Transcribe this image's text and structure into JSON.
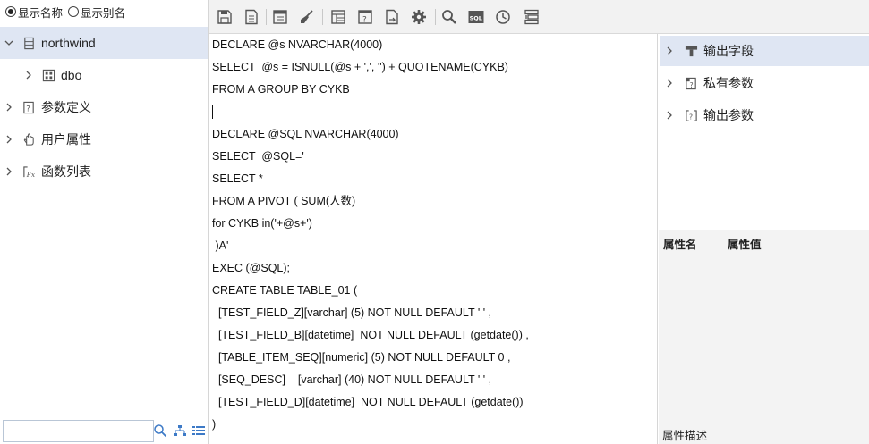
{
  "display_options": {
    "show_name": "显示名称",
    "show_alias": "显示别名",
    "selected": "show_name"
  },
  "tree": {
    "database": "northwind",
    "schema": "dbo",
    "params_def": "参数定义",
    "user_props": "用户属性",
    "func_list": "函数列表"
  },
  "search": {
    "value": "",
    "placeholder": ""
  },
  "toolbar": {
    "items": [
      "save-icon",
      "save-as-icon",
      "window-icon",
      "clear-icon",
      "layout-icon",
      "param-icon",
      "export-icon",
      "settings-icon",
      "find-icon",
      "sql-icon",
      "history-icon",
      "format-icon"
    ],
    "sql_text": "SQL"
  },
  "editor": {
    "lines": [
      "DECLARE @s NVARCHAR(4000)",
      "SELECT  @s = ISNULL(@s + ',', '') + QUOTENAME(CYKB)",
      "FROM A GROUP BY CYKB",
      "",
      "DECLARE @SQL NVARCHAR(4000)",
      "SELECT  @SQL='",
      "SELECT *",
      "FROM A PIVOT ( SUM(人数)",
      "for CYKB in('+@s+')",
      " )A'",
      "EXEC (@SQL);",
      "CREATE TABLE TABLE_01 (",
      "  [TEST_FIELD_Z][varchar] (5) NOT NULL DEFAULT ' ' ,",
      "  [TEST_FIELD_B][datetime]  NOT NULL DEFAULT (getdate()) ,",
      "  [TABLE_ITEM_SEQ][numeric] (5) NOT NULL DEFAULT 0 ,",
      "  [SEQ_DESC]    [varchar] (40) NOT NULL DEFAULT ' ' ,",
      "  [TEST_FIELD_D][datetime]  NOT NULL DEFAULT (getdate())",
      ")"
    ]
  },
  "right_panel": {
    "output_fields": "输出字段",
    "private_params": "私有参数",
    "output_params": "输出参数",
    "prop_name": "属性名",
    "prop_value": "属性值",
    "prop_desc": "属性描述"
  },
  "colors": {
    "selection": "#dfe6f3",
    "toolbar_bg": "#f2f2f2",
    "panel_bg": "#f3f3f3",
    "icon": "#555555"
  }
}
